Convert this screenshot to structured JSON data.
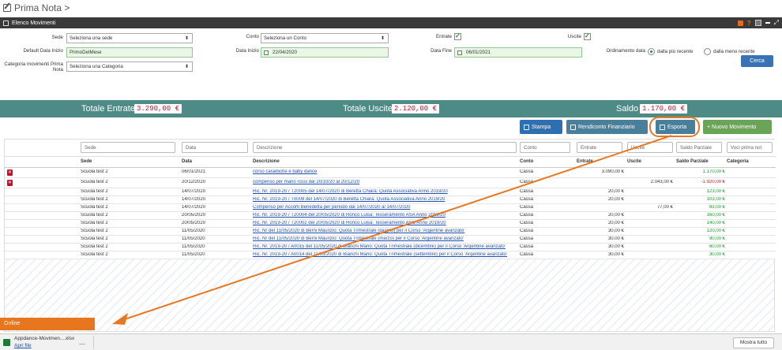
{
  "page": {
    "title": "Prima Nota >"
  },
  "panel": {
    "title": "Elenco Movimenti"
  },
  "filters": {
    "sede_label": "Sede",
    "sede_value": "Seleziona una sede",
    "conto_label": "Conto",
    "conto_value": "Seleziona un Conto",
    "entrate_label": "Entrate",
    "uscite_label": "Uscite",
    "default_data_label": "Default Data Inizio",
    "default_data_value": "PrimoDelMese",
    "data_inizio_label": "Data Inizio",
    "data_inizio_value": "22/04/2020",
    "data_fine_label": "Data Fine",
    "data_fine_value": "06/01/2021",
    "ordinamento_label": "Ordinamento data",
    "opt_recente": "dalla più recente",
    "opt_meno_recente": "dalla meno recente",
    "categoria_label_1": "Categoria movimenti Prima",
    "categoria_label_2": "Nota",
    "categoria_value": "Seleziona una Categoria",
    "cerca": "Cerca"
  },
  "totals": {
    "entrate_label": "Totale Entrate",
    "entrate_value": "3.290,00 €",
    "uscite_label": "Totale Uscite",
    "uscite_value": "2.120,00 €",
    "saldo_label": "Saldo",
    "saldo_value": "1.170,00 €"
  },
  "actions": {
    "stampa": "Stampa",
    "rendiconto": "Rendiconto Finanziario",
    "esporta": "Esporta",
    "nuovo": "+ Nuovo Movimento",
    "colors": {
      "stampa": "#2e6fb2",
      "rendiconto": "#4a7f9c",
      "esporta": "#4a7f9c",
      "nuovo": "#6aa457"
    }
  },
  "search": {
    "sede": "Sede",
    "data": "Data",
    "descrizione": "Descrizione",
    "conto": "Conto",
    "entrate": "Entrate",
    "uscite": "Uscite",
    "saldo": "Saldo Parziale",
    "voci": "Voci prima not"
  },
  "columns": [
    "Sede",
    "Data",
    "Descrizione",
    "Conto",
    "Entrate",
    "Uscite",
    "Saldo Parziale",
    "Categoria"
  ],
  "rows": [
    {
      "sede": "Scuola test 2",
      "data": "06/01/2021",
      "desc": "corso caraibiche e baby dance",
      "conto": "Cassa",
      "entrate": "3.090,00 €",
      "uscite": "",
      "saldo": "1.170,00 €",
      "neg": false,
      "del": true
    },
    {
      "sede": "Scuola test 2",
      "data": "20/12/2020",
      "desc": "compenso per mario rossi dal 20/10/20 al 20/12/20",
      "conto": "Cassa",
      "entrate": "",
      "uscite": "2.043,00 €",
      "saldo": "-1.920,00 €",
      "neg": true,
      "del": true
    },
    {
      "sede": "Scuola test 2",
      "data": "14/07/2020",
      "desc": "Ric. Nr. 2019-20 / T20005 del 14/07/2020 di Beretta Chiara: Quota Associativa Anno 2019/20",
      "conto": "Cassa",
      "entrate": "20,00 €",
      "uscite": "",
      "saldo": "123,00 €",
      "neg": false,
      "del": false
    },
    {
      "sede": "Scuola test 2",
      "data": "14/07/2020",
      "desc": "Ric. Nr. 2019-20 / T0009 del 14/07/2020 di Beretta Chiara: Quota Associativa Anno 2019/20",
      "conto": "Cassa",
      "entrate": "20,00 €",
      "uscite": "",
      "saldo": "103,00 €",
      "neg": false,
      "del": false
    },
    {
      "sede": "Scuola test 2",
      "data": "14/07/2020",
      "desc": "Compenso per Accorti Benedetta per periodo dal 14/07/2020 al 14/07/2020",
      "conto": "Cassa",
      "entrate": "",
      "uscite": "77,00 €",
      "saldo": "83,00 €",
      "neg": false,
      "del": false
    },
    {
      "sede": "Scuola test 2",
      "data": "20/05/2020",
      "desc": "Ric. Nr. 2019-20 / T20004 del 20/05/2020 di Ronco Luisa: Tesseramento ASA Anno 2019/20",
      "conto": "Cassa",
      "entrate": "20,00 €",
      "uscite": "",
      "saldo": "160,00 €",
      "neg": false,
      "del": false
    },
    {
      "sede": "Scuola test 2",
      "data": "20/05/2020",
      "desc": "Ric. Nr. 2019-20 / T20002 del 20/05/2020 di Ronco Luisa: Tesseramento ASC Anno 2019/20",
      "conto": "Cassa",
      "entrate": "20,00 €",
      "uscite": "",
      "saldo": "140,00 €",
      "neg": false,
      "del": false
    },
    {
      "sede": "Scuola test 2",
      "data": "11/05/2020",
      "desc": "Ric. Nr del 11/05/2020 di Berni Maurizio: Quota Trimestrale (giugno) per il Corso 'Argentine avanzato'",
      "conto": "Cassa",
      "entrate": "30,00 €",
      "uscite": "",
      "saldo": "120,00 €",
      "neg": false,
      "del": false
    },
    {
      "sede": "Scuola test 2",
      "data": "11/05/2020",
      "desc": "Ric. Nr del 11/05/2020 di Berni Maurizio: Quota Trimestrale (marzo) per il Corso 'Argentine avanzato'",
      "conto": "Cassa",
      "entrate": "30,00 €",
      "uscite": "",
      "saldo": "90,00 €",
      "neg": false,
      "del": false
    },
    {
      "sede": "Scuola test 2",
      "data": "11/05/2020",
      "desc": "Ric. Nr. 2019-20 / A0015 del 11/05/2020 di Bianchi Mario: Quota Trimestrale (dicembre) per il Corso 'Argentine avanzato'",
      "conto": "Cassa",
      "entrate": "30,00 €",
      "uscite": "",
      "saldo": "60,00 €",
      "neg": false,
      "del": false
    },
    {
      "sede": "Scuola test 2",
      "data": "11/05/2020",
      "desc": "Ric. Nr. 2019-20 / A0014 del 11/05/2020 di Bianchi Mario: Quota Trimestrale (settembre) per il Corso 'Argentine avanzato'",
      "conto": "Cassa",
      "entrate": "30,00 €",
      "uscite": "",
      "saldo": "30,00 €",
      "neg": false,
      "del": false
    }
  ],
  "status": {
    "online": "Online"
  },
  "download": {
    "filename": "Appdance-Movimen....xlsx",
    "open": "Apri file",
    "more": "...",
    "show_all": "Mostra tutto"
  },
  "colors": {
    "accent": "#e87722",
    "totals_bg": "#4e8b86",
    "primary": "#3a73b5",
    "negative": "#d0112a",
    "positive": "#1a9a2a"
  }
}
